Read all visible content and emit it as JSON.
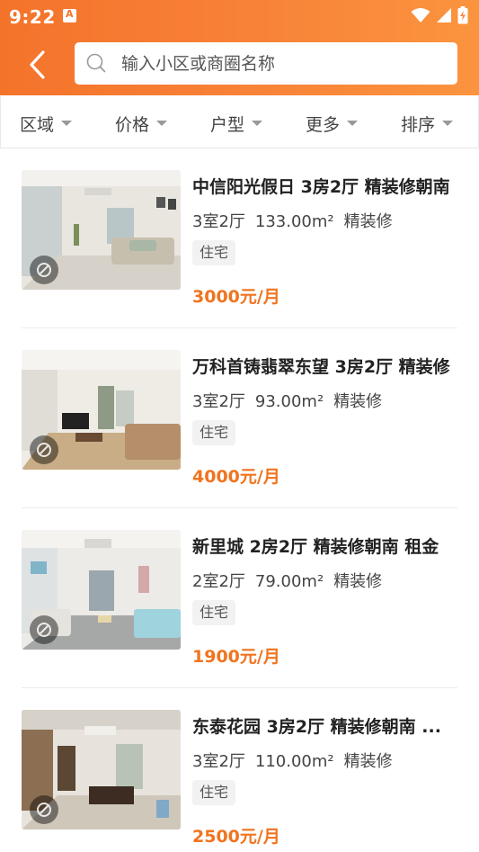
{
  "status_bar": {
    "time": "9:22"
  },
  "search": {
    "placeholder": "输入小区或商圈名称"
  },
  "filters": [
    {
      "label": "区域"
    },
    {
      "label": "价格"
    },
    {
      "label": "户型"
    },
    {
      "label": "更多"
    },
    {
      "label": "排序"
    }
  ],
  "listings": [
    {
      "title": "中信阳光假日 3房2厅  精装修朝南",
      "rooms": "3室2厅",
      "area": "133.00m²",
      "decoration": "精装修",
      "tag": "住宅",
      "price": "3000元/月"
    },
    {
      "title": "万科首铸翡翠东望 3房2厅  精装修",
      "rooms": "3室2厅",
      "area": "93.00m²",
      "decoration": "精装修",
      "tag": "住宅",
      "price": "4000元/月"
    },
    {
      "title": "新里城 2房2厅  精装修朝南 租金",
      "rooms": "2室2厅",
      "area": "79.00m²",
      "decoration": "精装修",
      "tag": "住宅",
      "price": "1900元/月"
    },
    {
      "title": "东泰花园 3房2厅  精装修朝南 ...",
      "rooms": "3室2厅",
      "area": "110.00m²",
      "decoration": "精装修",
      "tag": "住宅",
      "price": "2500元/月"
    }
  ],
  "icons": {
    "back": "chevron-left-icon",
    "search": "search-icon",
    "filter_caret": "caret-down-icon",
    "vr": "vr-view-icon",
    "wifi": "wifi-icon",
    "signal": "signal-icon",
    "battery": "battery-charging-icon",
    "notification": "app-notification-icon"
  },
  "colors": {
    "header_start": "#f4732b",
    "header_end": "#fb943e",
    "price": "#f0741f"
  }
}
